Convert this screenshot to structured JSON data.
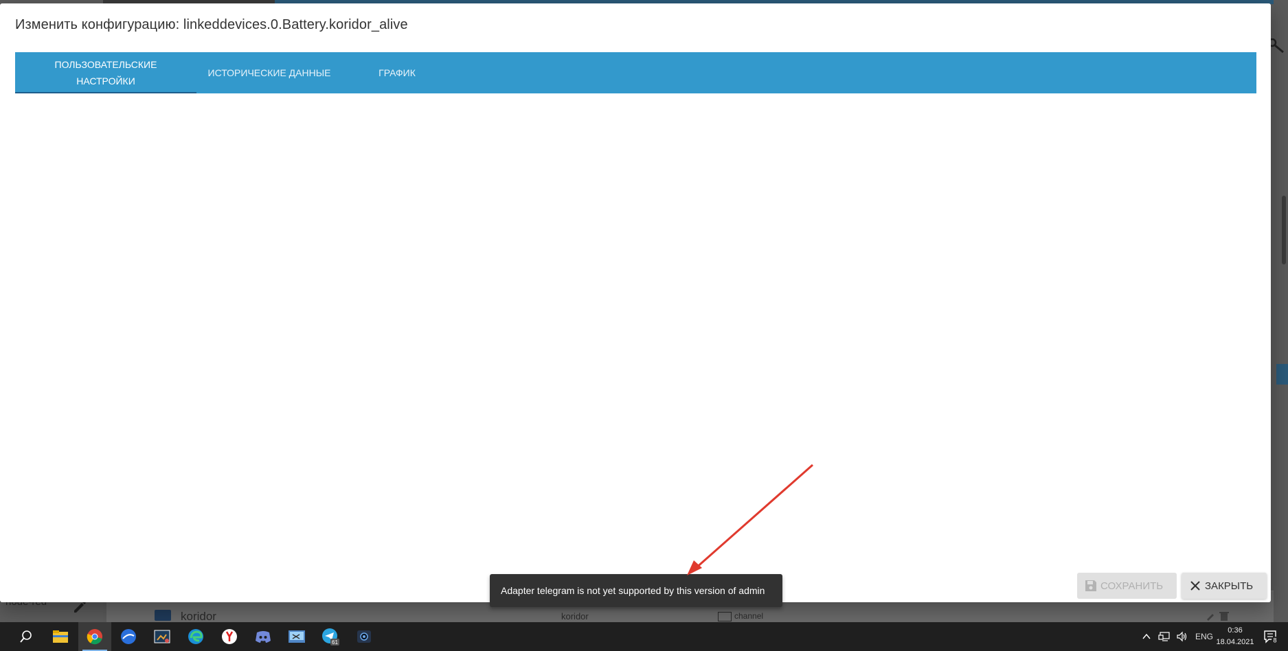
{
  "dialog": {
    "title": "Изменить конфигурацию: linkeddevices.0.Battery.koridor_alive",
    "tabs": [
      {
        "label": "Пользовательские настройки",
        "active": true
      },
      {
        "label": "Исторические данные",
        "active": false
      },
      {
        "label": "График",
        "active": false
      }
    ],
    "buttons": {
      "save": "Сохранить",
      "close": "Закрыть"
    }
  },
  "snackbar": {
    "message": "Adapter telegram is not yet supported by this version of admin"
  },
  "background": {
    "left_label": "node-red",
    "row_name": "koridor",
    "row_col2": "koridor",
    "row_type": "channel"
  },
  "taskbar": {
    "language": "ENG",
    "time": "0:36",
    "date": "18.04.2021",
    "notifications": "8",
    "telegram_badge": "61"
  },
  "colors": {
    "tab_bar": "#3399cc",
    "snackbar": "#323232",
    "arrow": "#e03a2e"
  }
}
